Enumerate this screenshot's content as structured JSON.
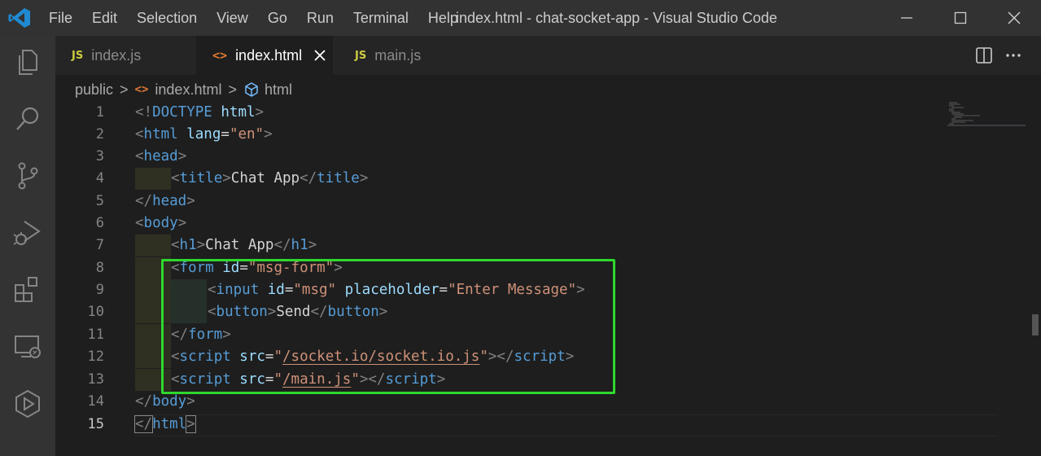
{
  "menu": [
    "File",
    "Edit",
    "Selection",
    "View",
    "Go",
    "Run",
    "Terminal",
    "Help"
  ],
  "window_title": "index.html - chat-socket-app - Visual Studio Code",
  "tabs": [
    {
      "badge": "JS",
      "label": "index.js",
      "active": false
    },
    {
      "badge": "<>",
      "label": "index.html",
      "active": true
    },
    {
      "badge": "JS",
      "label": "main.js",
      "active": false
    }
  ],
  "breadcrumb": {
    "folder": "public",
    "file_icon": "<>",
    "file": "index.html",
    "element": "html",
    "sep": ">"
  },
  "line_numbers": [
    "1",
    "2",
    "3",
    "4",
    "5",
    "6",
    "7",
    "8",
    "9",
    "10",
    "11",
    "12",
    "13",
    "14",
    "15"
  ],
  "code": {
    "l1": [
      "<!",
      "DOCTYPE",
      " html",
      ">"
    ],
    "l2": [
      "<",
      "html",
      " lang",
      "=",
      "\"en\"",
      ">"
    ],
    "l3": [
      "<",
      "head",
      ">"
    ],
    "l4": [
      "<",
      "title",
      ">",
      "Chat App",
      "</",
      "title",
      ">"
    ],
    "l5": [
      "</",
      "head",
      ">"
    ],
    "l6": [
      "<",
      "body",
      ">"
    ],
    "l7": [
      "<",
      "h1",
      ">",
      "Chat App",
      "</",
      "h1",
      ">"
    ],
    "l8": [
      "<",
      "form",
      " id",
      "=",
      "\"msg-form\"",
      ">"
    ],
    "l9": [
      "<",
      "input",
      " id",
      "=",
      "\"msg\"",
      " placeholder",
      "=",
      "\"Enter Message\"",
      ">"
    ],
    "l10": [
      "<",
      "button",
      ">",
      "Send",
      "</",
      "button",
      ">"
    ],
    "l11": [
      "</",
      "form",
      ">"
    ],
    "l12": [
      "<",
      "script",
      " src",
      "=",
      "\"",
      "/socket.io/socket.io.js",
      "\"",
      "></",
      "script",
      ">"
    ],
    "l13": [
      "<",
      "script",
      " src",
      "=",
      "\"",
      "/main.js",
      "\"",
      "></",
      "script",
      ">"
    ],
    "l14": [
      "</",
      "body",
      ">"
    ],
    "l15": [
      "</",
      "html",
      ">"
    ]
  },
  "colors": {
    "highlight": "#2ed82e",
    "tag": "#569cd6",
    "attr": "#9cdcfe",
    "string": "#ce9178"
  }
}
